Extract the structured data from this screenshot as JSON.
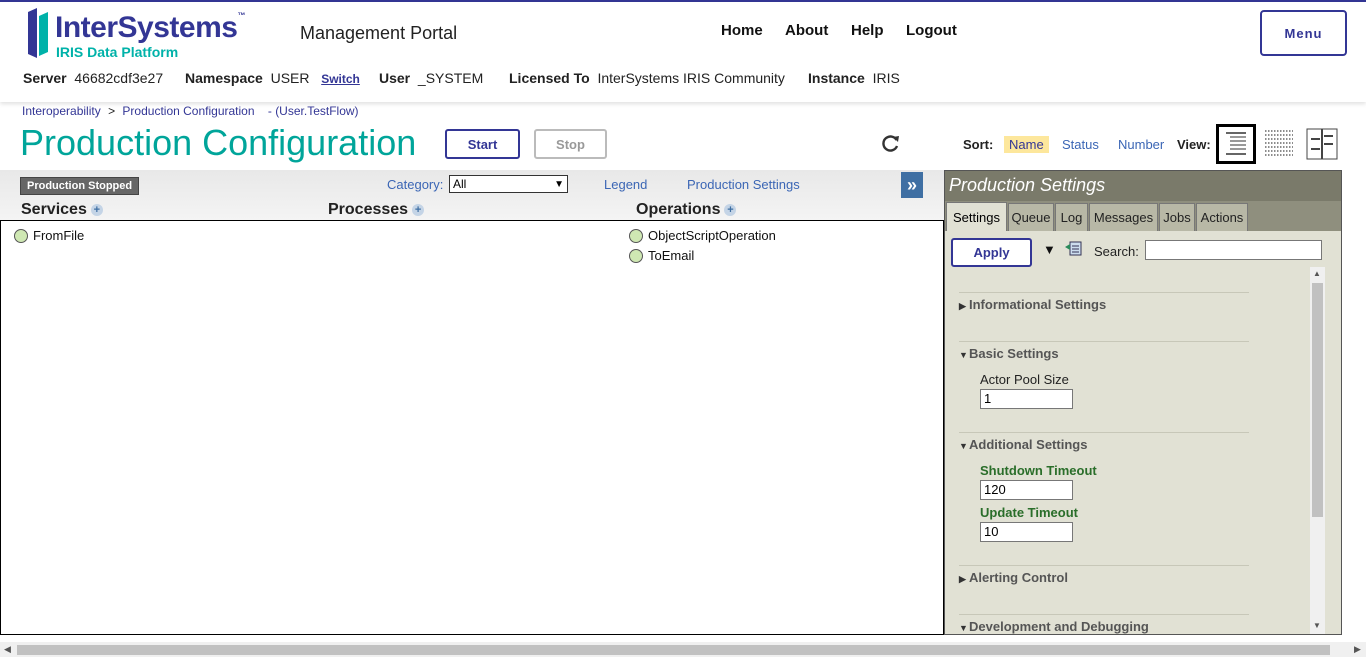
{
  "brand": {
    "name": "InterSystems",
    "trademark": "™",
    "product": "IRIS Data Platform",
    "portal_title": "Management Portal",
    "colors": {
      "primary": "#333695",
      "accent": "#00b2a9"
    }
  },
  "topnav": {
    "home": "Home",
    "about": "About",
    "help": "Help",
    "logout": "Logout",
    "menu": "Menu"
  },
  "info": {
    "server_label": "Server",
    "server": "46682cdf3e27",
    "namespace_label": "Namespace",
    "namespace": "USER",
    "switch": "Switch",
    "user_label": "User",
    "user": "_SYSTEM",
    "licensed_label": "Licensed To",
    "licensed": "InterSystems IRIS Community",
    "instance_label": "Instance",
    "instance": "IRIS"
  },
  "breadcrumb": {
    "root": "Interoperability",
    "sep": ">",
    "current": "Production Configuration",
    "suffix": "- (User.TestFlow)"
  },
  "page": {
    "title": "Production Configuration",
    "start": "Start",
    "stop": "Stop"
  },
  "sort": {
    "label": "Sort:",
    "name": "Name",
    "status": "Status",
    "number": "Number",
    "view_label": "View:"
  },
  "diagram": {
    "status": "Production Stopped",
    "category_label": "Category:",
    "category_value": "All",
    "legend": "Legend",
    "settings_link": "Production Settings",
    "expand": "»",
    "columns": {
      "services": "Services",
      "processes": "Processes",
      "operations": "Operations"
    },
    "services": [
      "FromFile"
    ],
    "operations": [
      "ObjectScriptOperation",
      "ToEmail"
    ]
  },
  "panel": {
    "title": "Production Settings",
    "tabs": [
      "Settings",
      "Queue",
      "Log",
      "Messages",
      "Jobs",
      "Actions"
    ],
    "apply": "Apply",
    "search_label": "Search:",
    "search_value": "",
    "sections": {
      "informational": "Informational Settings",
      "basic": "Basic Settings",
      "additional": "Additional Settings",
      "alerting": "Alerting Control",
      "development": "Development and Debugging"
    },
    "fields": {
      "actor_pool_label": "Actor Pool Size",
      "actor_pool_value": "1",
      "shutdown_label": "Shutdown Timeout",
      "shutdown_value": "120",
      "update_label": "Update Timeout",
      "update_value": "10"
    }
  }
}
